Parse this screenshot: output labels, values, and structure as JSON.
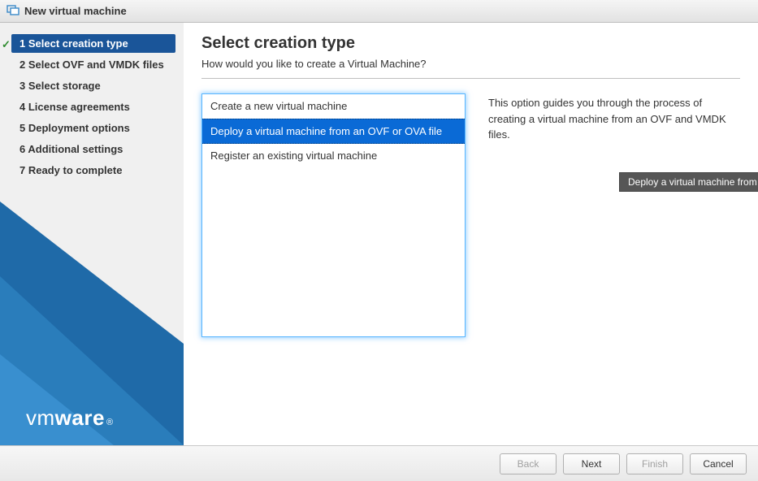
{
  "window": {
    "title": "New virtual machine"
  },
  "sidebar": {
    "steps": [
      {
        "num": "1",
        "label": "Select creation type",
        "active": true,
        "checked": true
      },
      {
        "num": "2",
        "label": "Select OVF and VMDK files",
        "active": false,
        "checked": false
      },
      {
        "num": "3",
        "label": "Select storage",
        "active": false,
        "checked": false
      },
      {
        "num": "4",
        "label": "License agreements",
        "active": false,
        "checked": false
      },
      {
        "num": "5",
        "label": "Deployment options",
        "active": false,
        "checked": false
      },
      {
        "num": "6",
        "label": "Additional settings",
        "active": false,
        "checked": false
      },
      {
        "num": "7",
        "label": "Ready to complete",
        "active": false,
        "checked": false
      }
    ],
    "brand": {
      "left": "vm",
      "right": "ware",
      "reg": "®"
    }
  },
  "content": {
    "heading": "Select creation type",
    "subtitle": "How would you like to create a Virtual Machine?",
    "options": [
      {
        "label": "Create a new virtual machine",
        "selected": false
      },
      {
        "label": "Deploy a virtual machine from an OVF or OVA file",
        "selected": true
      },
      {
        "label": "Register an existing virtual machine",
        "selected": false
      }
    ],
    "description": "This option guides you through the process of creating a virtual machine from an OVF and VMDK files.",
    "tooltip": "Deploy a virtual machine from an OVF or OVA file"
  },
  "footer": {
    "back": "Back",
    "next": "Next",
    "finish": "Finish",
    "cancel": "Cancel"
  }
}
